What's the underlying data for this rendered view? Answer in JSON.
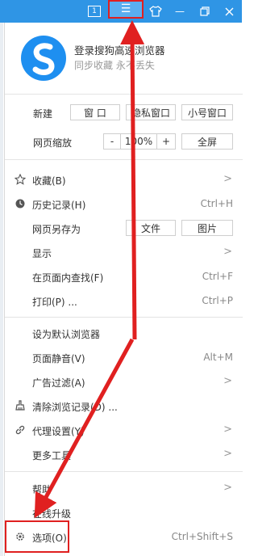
{
  "titlebar": {
    "tab_count": "1",
    "menu_glyph": "☰",
    "skin_glyph": "👕",
    "minimize_glyph": "—",
    "restore_glyph": "❐",
    "close_glyph": "✕"
  },
  "profile": {
    "title": "登录搜狗高速浏览器",
    "subtitle": "同步收藏 永不丢失"
  },
  "new_row": {
    "label": "新建",
    "window": "窗 口",
    "private": "隐私窗口",
    "small": "小号窗口"
  },
  "zoom_row": {
    "label": "网页缩放",
    "minus": "-",
    "value": "100%",
    "plus": "+",
    "fullscreen": "全屏"
  },
  "items": {
    "favorites": "收藏(B)",
    "history": "历史记录(H)",
    "history_shortcut": "Ctrl+H",
    "saveas": "网页另存为",
    "saveas_file": "文件",
    "saveas_image": "图片",
    "display": "显示",
    "find": "在页面内查找(F)",
    "find_shortcut": "Ctrl+F",
    "print": "打印(P) ...",
    "print_shortcut": "Ctrl+P",
    "default_browser": "设为默认浏览器",
    "mute": "页面静音(V)",
    "mute_shortcut": "Alt+M",
    "adfilter": "广告过滤(A)",
    "clear": "清除浏览记录(D) ...",
    "proxy": "代理设置(Y)",
    "more_tools": "更多工具",
    "help": "帮助",
    "upgrade": "在线升级",
    "options": "选项(O)",
    "options_shortcut": "Ctrl+Shift+S"
  },
  "colors": {
    "titlebar": "#2f95e5",
    "annotation": "#e02020"
  }
}
